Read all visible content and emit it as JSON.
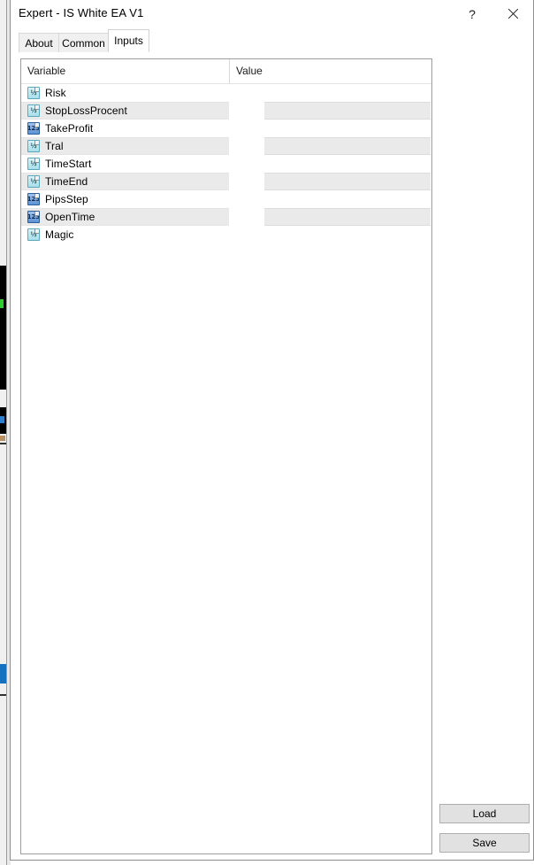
{
  "window": {
    "title": "Expert - IS White EA V1",
    "help_label": "?",
    "close_label": "×"
  },
  "tabs": [
    {
      "label": "About",
      "active": false
    },
    {
      "label": "Common",
      "active": false
    },
    {
      "label": "Inputs",
      "active": true
    }
  ],
  "inputs_table": {
    "columns": {
      "variable": "Variable",
      "value": "Value"
    },
    "rows": [
      {
        "name": "Risk",
        "value": "",
        "icon": "half-fraction-icon",
        "type": "double"
      },
      {
        "name": "StopLossProcent",
        "value": "",
        "icon": "half-fraction-icon",
        "type": "double"
      },
      {
        "name": "TakeProfit",
        "value": "",
        "icon": "integer-123-icon",
        "type": "integer"
      },
      {
        "name": "Tral",
        "value": "",
        "icon": "half-fraction-icon",
        "type": "double"
      },
      {
        "name": "TimeStart",
        "value": "",
        "icon": "half-fraction-icon",
        "type": "double"
      },
      {
        "name": "TimeEnd",
        "value": "",
        "icon": "half-fraction-icon",
        "type": "double"
      },
      {
        "name": "PipsStep",
        "value": "",
        "icon": "integer-123-icon",
        "type": "integer"
      },
      {
        "name": "OpenTime",
        "value": "",
        "icon": "integer-123-icon",
        "type": "integer"
      },
      {
        "name": "Magic",
        "value": "",
        "icon": "half-fraction-icon",
        "type": "double"
      }
    ]
  },
  "actions": {
    "load_label": "Load",
    "save_label": "Save"
  },
  "icon_glyphs": {
    "half-fraction-icon": "½",
    "integer-123-icon": "123"
  },
  "colors": {
    "dialog_background": "#ffffff",
    "panel_border": "#9c9c9c",
    "alt_row": "#eaeaea",
    "button_face": "#e1e1e1",
    "button_border": "#adadad",
    "tab_inactive": "#f0f0f0",
    "double_icon": "#a9dfe9",
    "integer_icon": "#5d92d4"
  }
}
